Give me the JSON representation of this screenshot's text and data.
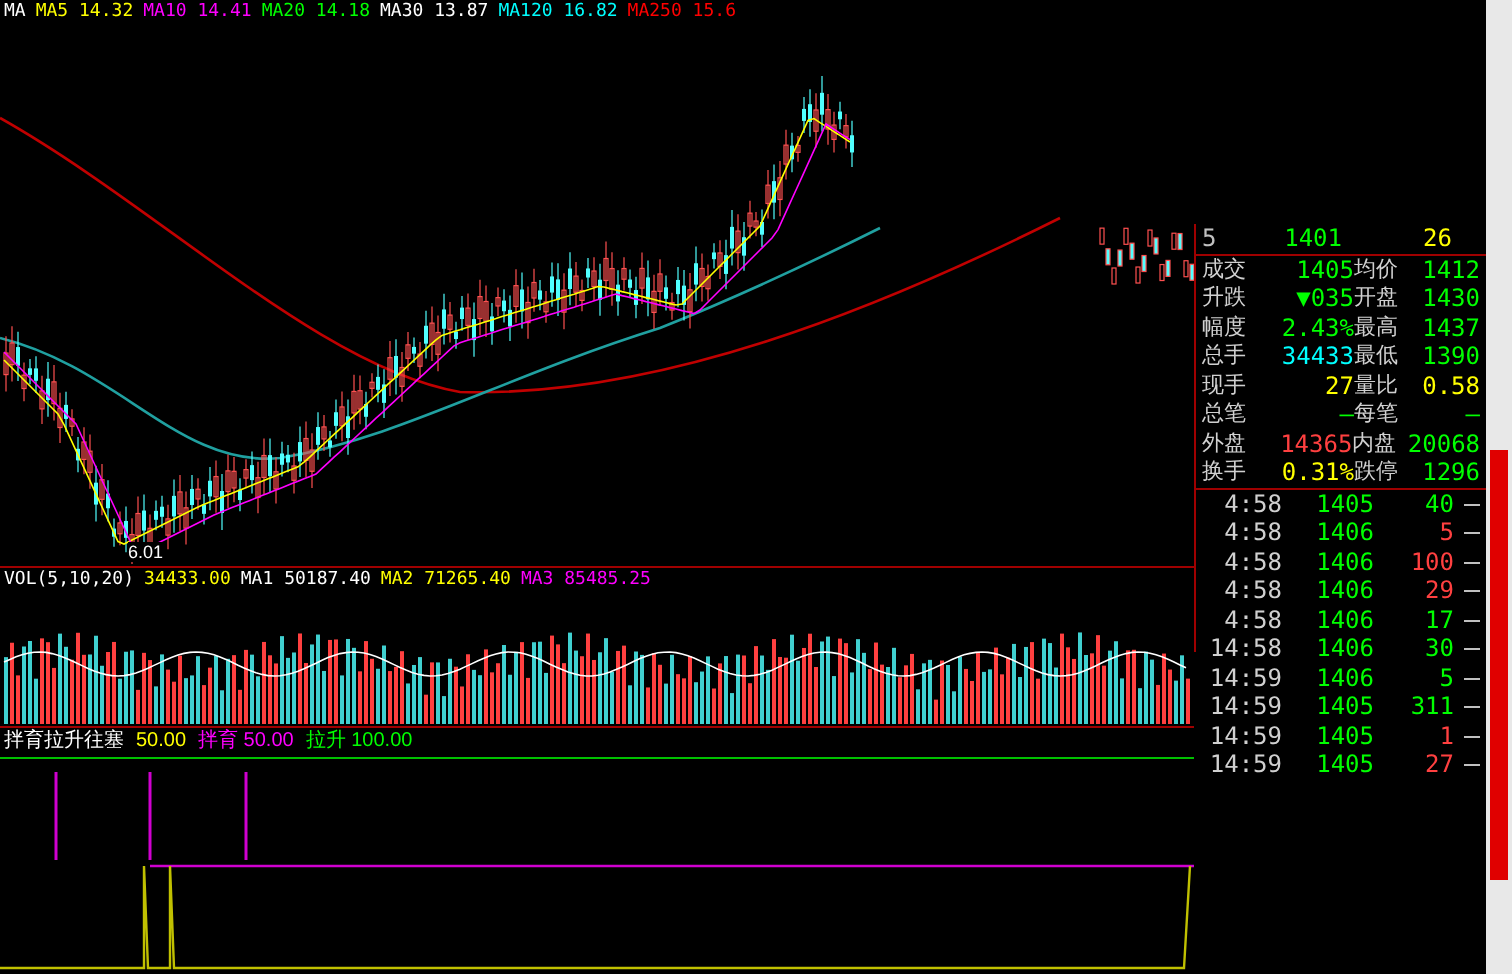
{
  "ma_legend": [
    {
      "label": "MA",
      "color": "#ffffff"
    },
    {
      "label": "MA5 14.32",
      "color": "#ffff00"
    },
    {
      "label": "MA10 14.41",
      "color": "#ff00ff"
    },
    {
      "label": "MA20 14.18",
      "color": "#00ff00"
    },
    {
      "label": "MA30 13.87",
      "color": "#ffffff"
    },
    {
      "label": "MA120 16.82",
      "color": "#00ffff"
    },
    {
      "label": "MA250 15.6",
      "color": "#ff0000"
    }
  ],
  "low_label": "6.01",
  "vol_legend": [
    {
      "label": "VOL(5,10,20)",
      "color": "#ffffff"
    },
    {
      "label": "34433.00",
      "color": "#ffff00"
    },
    {
      "label": "MA1 50187.40",
      "color": "#ffffff"
    },
    {
      "label": "MA2 71265.40",
      "color": "#ffff00"
    },
    {
      "label": "MA3 85485.25",
      "color": "#ff00ff"
    }
  ],
  "indicator_legend": [
    {
      "label": "拌育拉升往塞",
      "color": "#ffffff"
    },
    {
      "label": "50.00",
      "color": "#ffff00"
    },
    {
      "label": "拌育 50.00",
      "color": "#ff00ff"
    },
    {
      "label": "拉升 100.00",
      "color": "#00ff00"
    }
  ],
  "order_row": {
    "level": "5",
    "price": "1401",
    "volume": "26"
  },
  "quote_rows": [
    {
      "cells": [
        {
          "label": "成交",
          "value": "1405",
          "color": "#00ff00"
        },
        {
          "label": "均价",
          "value": "1412",
          "color": "#00ff00"
        }
      ]
    },
    {
      "cells": [
        {
          "label": "升跌",
          "value": "▼035",
          "color": "#00ff00"
        },
        {
          "label": "开盘",
          "value": "1430",
          "color": "#00ff00"
        }
      ]
    },
    {
      "cells": [
        {
          "label": "幅度",
          "value": "2.43%",
          "color": "#00ff00"
        },
        {
          "label": "最高",
          "value": "1437",
          "color": "#00ff00"
        }
      ]
    },
    {
      "cells": [
        {
          "label": "总手",
          "value": "34433",
          "color": "#00ffff"
        },
        {
          "label": "最低",
          "value": "1390",
          "color": "#00ff00"
        }
      ]
    },
    {
      "cells": [
        {
          "label": "现手",
          "value": "27",
          "color": "#ffff00"
        },
        {
          "label": "量比",
          "value": "0.58",
          "color": "#ffff00"
        }
      ]
    },
    {
      "cells": [
        {
          "label": "总笔",
          "value": "—",
          "color": "#00ff00"
        },
        {
          "label": "每笔",
          "value": "—",
          "color": "#00ff00"
        }
      ]
    },
    {
      "cells": [
        {
          "label": "外盘",
          "value": "14365",
          "color": "#ff4040"
        },
        {
          "label": "内盘",
          "value": "20068",
          "color": "#00ff00"
        }
      ]
    },
    {
      "cells": [
        {
          "label": "换手",
          "value": "0.31%",
          "color": "#ffff00"
        },
        {
          "label": "跌停",
          "value": "1296",
          "color": "#00ff00"
        }
      ]
    }
  ],
  "ticks": [
    {
      "time": "4:58",
      "price": "1405",
      "volume": "40",
      "color": "#00ff00"
    },
    {
      "time": "4:58",
      "price": "1406",
      "volume": "5",
      "color": "#ff4040"
    },
    {
      "time": "4:58",
      "price": "1406",
      "volume": "100",
      "color": "#ff4040"
    },
    {
      "time": "4:58",
      "price": "1406",
      "volume": "29",
      "color": "#ff4040"
    },
    {
      "time": "4:58",
      "price": "1406",
      "volume": "17",
      "color": "#00ff00"
    },
    {
      "time": "14:58",
      "price": "1406",
      "volume": "30",
      "color": "#00ff00"
    },
    {
      "time": "14:59",
      "price": "1406",
      "volume": "5",
      "color": "#00ff00"
    },
    {
      "time": "14:59",
      "price": "1405",
      "volume": "311",
      "color": "#00ff00"
    },
    {
      "time": "14:59",
      "price": "1405",
      "volume": "1",
      "color": "#ff4040"
    },
    {
      "time": "14:59",
      "price": "1405",
      "volume": "27",
      "color": "#ff4040"
    }
  ]
}
